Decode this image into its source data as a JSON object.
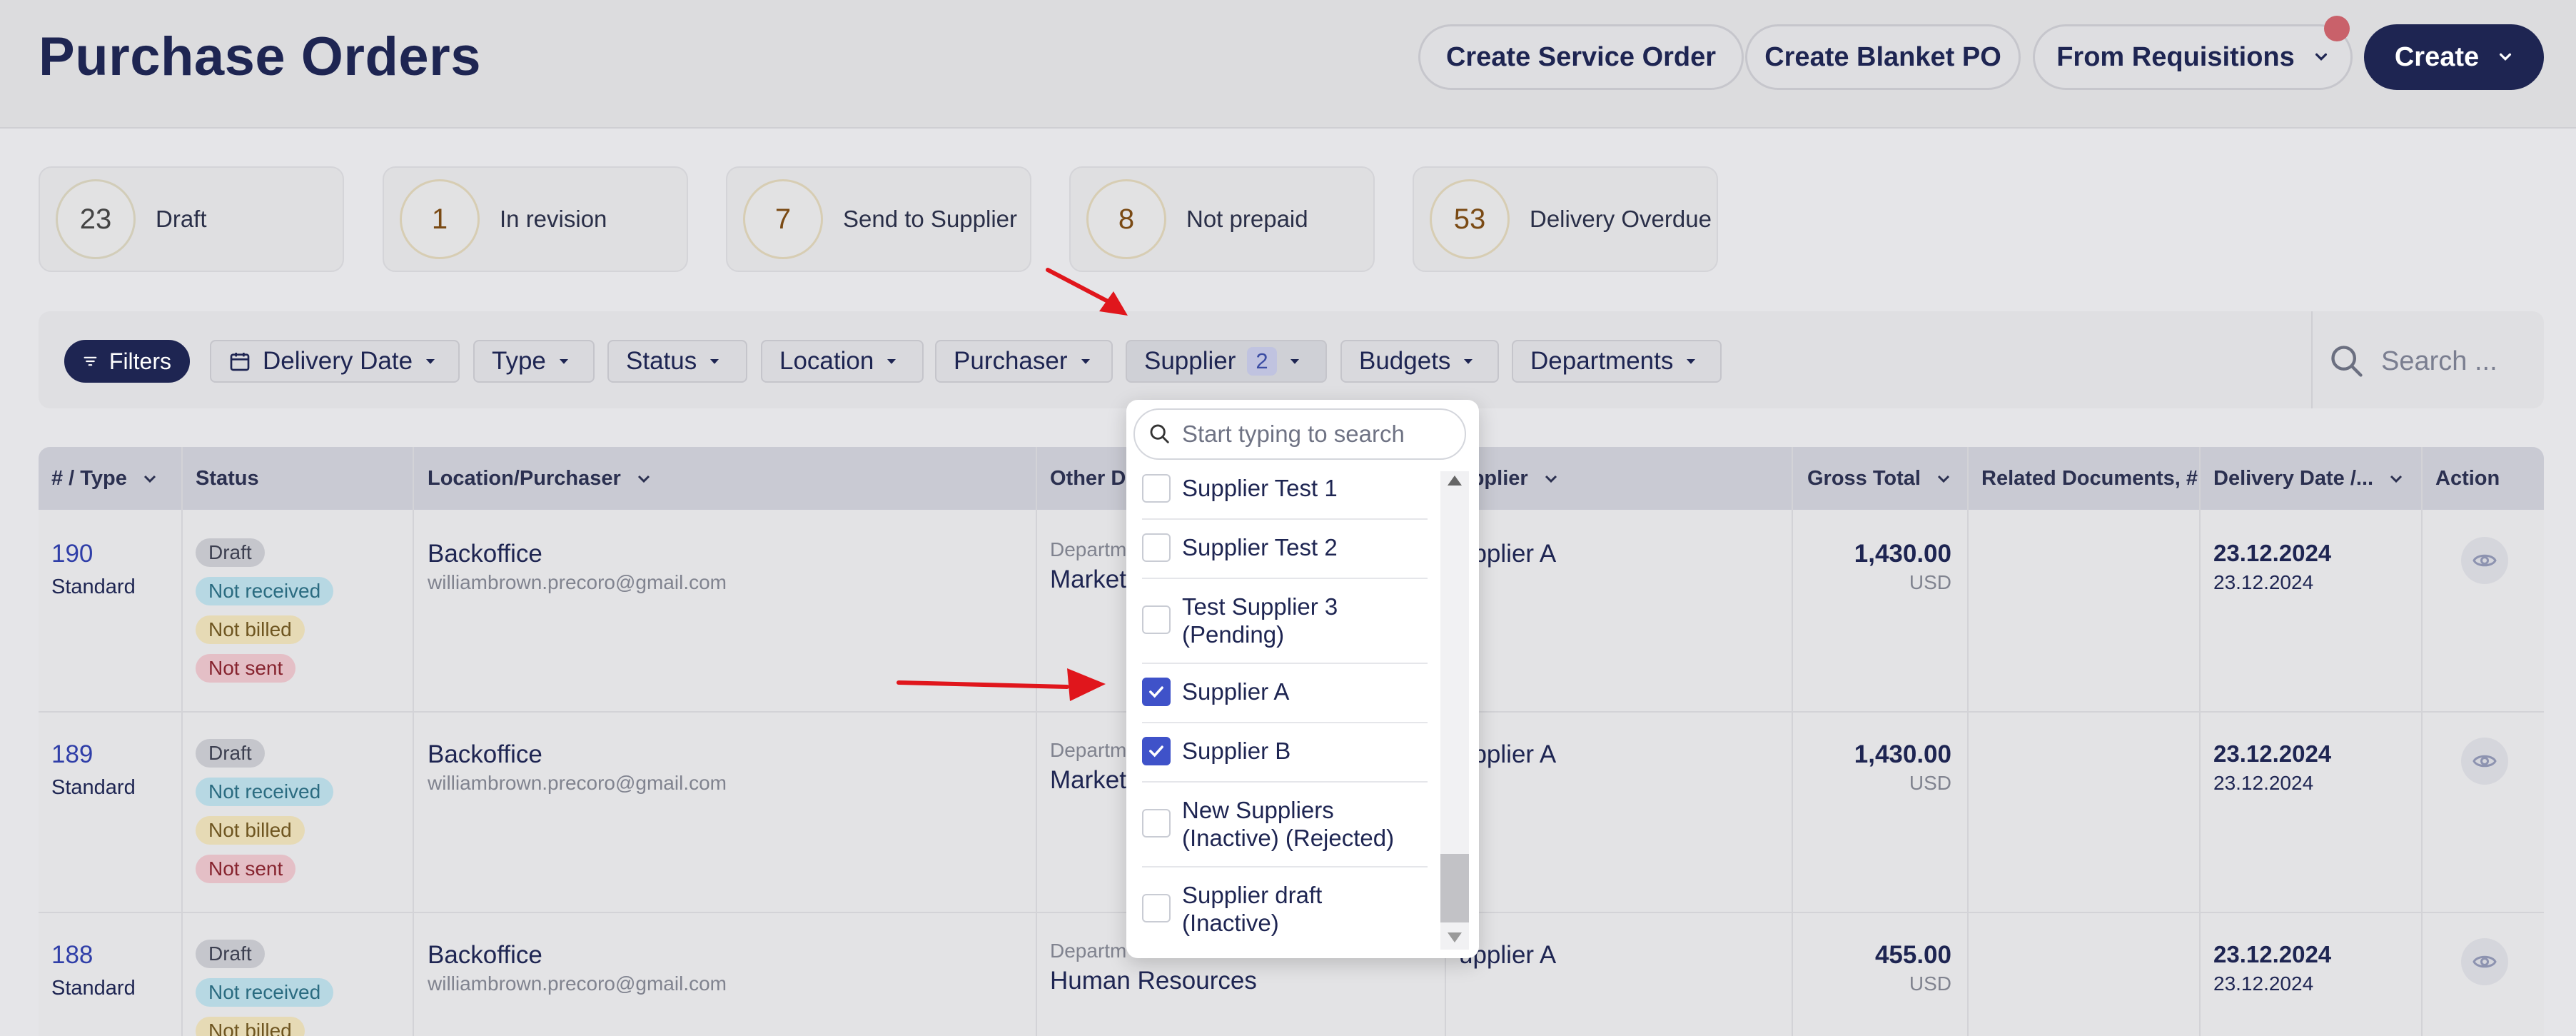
{
  "header": {
    "title": "Purchase Orders",
    "buttons": {
      "service_order": "Create Service Order",
      "blanket_po": "Create Blanket PO",
      "from_requisitions": "From Requisitions",
      "create": "Create"
    }
  },
  "stats": [
    {
      "count": "23",
      "label": "Draft"
    },
    {
      "count": "1",
      "label": "In revision"
    },
    {
      "count": "7",
      "label": "Send to Supplier"
    },
    {
      "count": "8",
      "label": "Not prepaid"
    },
    {
      "count": "53",
      "label": "Delivery Overdue"
    }
  ],
  "filters": {
    "filters_label": "Filters",
    "delivery_date": "Delivery Date",
    "type": "Type",
    "status": "Status",
    "location": "Location",
    "purchaser": "Purchaser",
    "supplier": "Supplier",
    "supplier_count": "2",
    "budgets": "Budgets",
    "departments": "Departments",
    "search_placeholder": "Search ..."
  },
  "table": {
    "headers": {
      "num_type": "# / Type",
      "status": "Status",
      "location": "Location/Purchaser",
      "other": "Other De",
      "supplier": "upplier",
      "gross": "Gross Total",
      "related": "Related Documents, #",
      "delivery": "Delivery Date /...",
      "action": "Action"
    },
    "rows": [
      {
        "num": "190",
        "type": "Standard",
        "statuses": [
          "Draft",
          "Not received",
          "Not billed",
          "Not sent"
        ],
        "location": "Backoffice",
        "email": "williambrown.precoro@gmail.com",
        "dept_label": "Departm",
        "dept": "Market",
        "supplier": "upplier A",
        "gross": "1,430.00",
        "currency": "USD",
        "date1": "23.12.2024",
        "date2": "23.12.2024"
      },
      {
        "num": "189",
        "type": "Standard",
        "statuses": [
          "Draft",
          "Not received",
          "Not billed",
          "Not sent"
        ],
        "location": "Backoffice",
        "email": "williambrown.precoro@gmail.com",
        "dept_label": "Departm",
        "dept": "Market",
        "supplier": "upplier A",
        "gross": "1,430.00",
        "currency": "USD",
        "date1": "23.12.2024",
        "date2": "23.12.2024"
      },
      {
        "num": "188",
        "type": "Standard",
        "statuses": [
          "Draft",
          "Not received",
          "Not billed"
        ],
        "location": "Backoffice",
        "email": "williambrown.precoro@gmail.com",
        "dept_label": "Departm",
        "dept": "Human Resources",
        "supplier": "upplier A",
        "gross": "455.00",
        "currency": "USD",
        "date1": "23.12.2024",
        "date2": "23.12.2024"
      }
    ]
  },
  "supplier_dropdown": {
    "search_placeholder": "Start typing to search",
    "items": [
      {
        "label": "Supplier Test 1",
        "checked": false
      },
      {
        "label": "Supplier Test 2",
        "checked": false
      },
      {
        "label": "Test Supplier 3\n(Pending)",
        "checked": false
      },
      {
        "label": "Supplier A",
        "checked": true
      },
      {
        "label": "Supplier B",
        "checked": true
      },
      {
        "label": "New Suppliers\n(Inactive) (Rejected)",
        "checked": false
      },
      {
        "label": "Supplier draft\n(Inactive)",
        "checked": false
      }
    ]
  },
  "colors": {
    "primary": "#1e2552",
    "accent": "#3f52c9",
    "annotation_arrow": "#e0161c",
    "notification": "#c9616a"
  }
}
